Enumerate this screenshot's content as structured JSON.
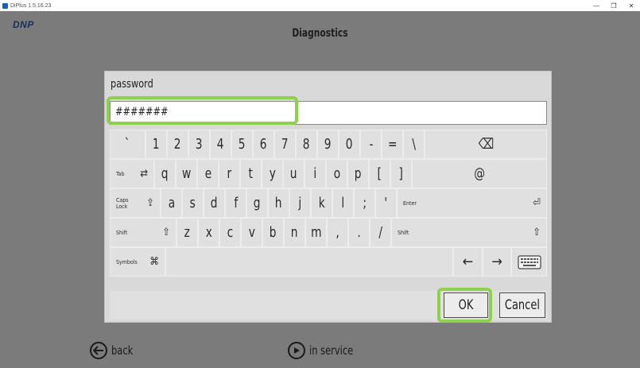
{
  "window": {
    "title": "DiPlus 1.5.16.23",
    "controls": [
      "—",
      "❐",
      "✕"
    ]
  },
  "header": {
    "brand": "DNP",
    "title": "Diagnostics"
  },
  "dialog": {
    "field_label": "password",
    "field_value": "#######"
  },
  "keyboard": {
    "row1": [
      "`",
      "1",
      "2",
      "3",
      "4",
      "5",
      "6",
      "7",
      "8",
      "9",
      "0",
      "-",
      "=",
      "\\",
      "⌫"
    ],
    "row2": {
      "tab_label": "Tab",
      "tab_icon": "⇄",
      "keys": [
        "q",
        "w",
        "e",
        "r",
        "t",
        "y",
        "u",
        "i",
        "o",
        "p",
        "[",
        "]",
        "@"
      ]
    },
    "row3": {
      "caps_label": "Caps Lock",
      "caps_icon": "⇪",
      "keys": [
        "a",
        "s",
        "d",
        "f",
        "g",
        "h",
        "j",
        "k",
        "l",
        ";",
        "'"
      ],
      "enter_label": "Enter",
      "enter_icon": "⏎"
    },
    "row4": {
      "shift_label": "Shift",
      "shift_icon": "⇧",
      "keys": [
        "z",
        "x",
        "c",
        "v",
        "b",
        "n",
        "m",
        ",",
        ".",
        "/"
      ]
    },
    "row5": {
      "symbols_label": "Symbols",
      "symbols_icon": "⌘",
      "left_arrow": "←",
      "right_arrow": "→",
      "keyboard_icon": "keyboard-icon"
    }
  },
  "buttons": {
    "ok": "OK",
    "cancel": "Cancel"
  },
  "nav": {
    "back": "back",
    "in_service": "in service"
  },
  "colors": {
    "background": "#7b7b7b",
    "dialog": "#d9d9d9",
    "key": "#e0e0e0",
    "highlight": "#8fd14f",
    "brand": "#1a2f5a"
  }
}
